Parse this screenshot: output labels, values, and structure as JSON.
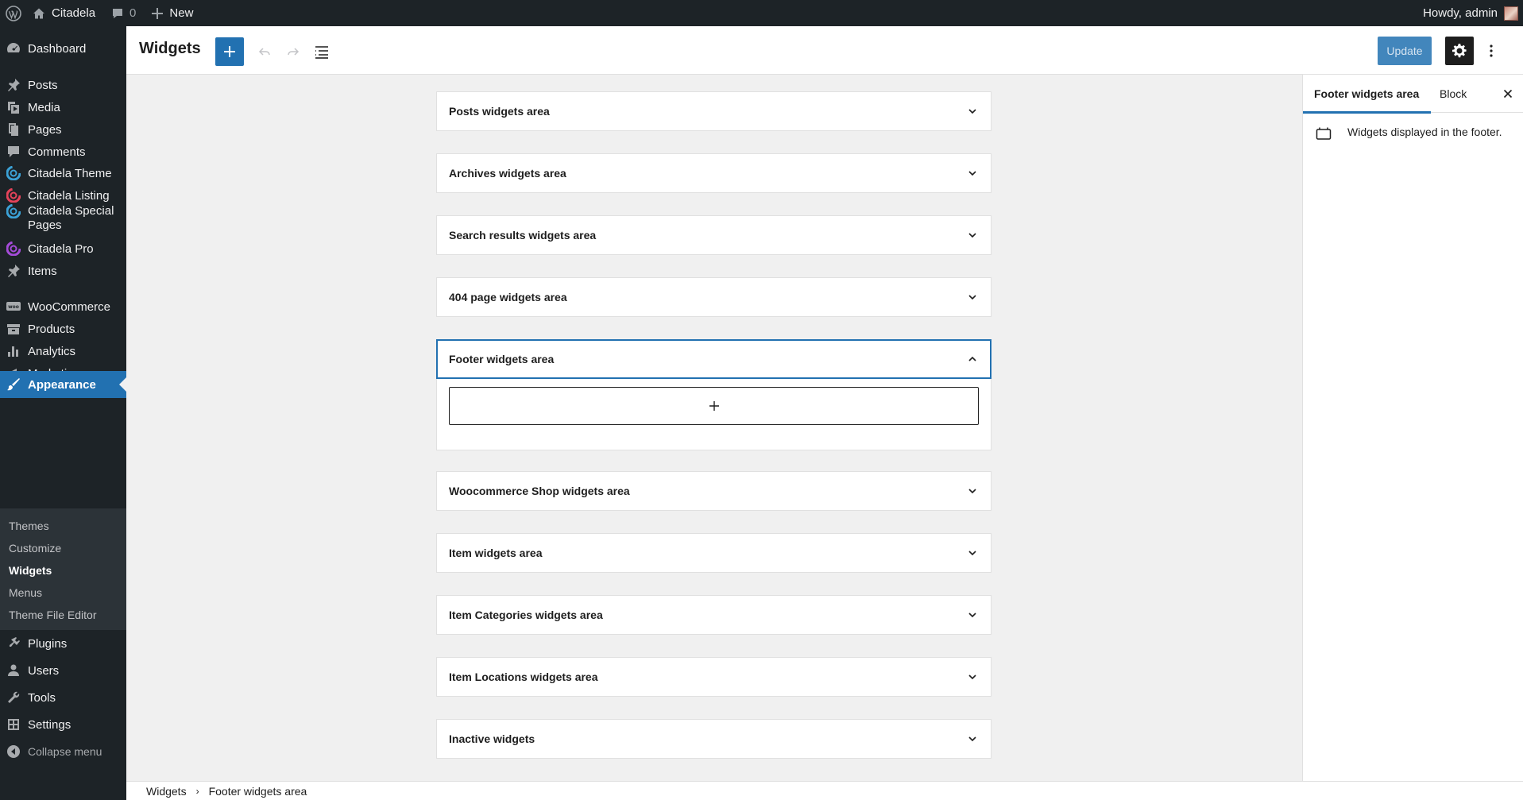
{
  "adminbar": {
    "site_name": "Citadela",
    "comment_count": "0",
    "new_label": "New",
    "greeting": "Howdy, admin"
  },
  "sidebar": {
    "items": [
      {
        "label": "Dashboard",
        "icon": "dashboard-icon"
      },
      {
        "label": "Posts",
        "icon": "pin-icon"
      },
      {
        "label": "Media",
        "icon": "media-icon"
      },
      {
        "label": "Pages",
        "icon": "pages-icon"
      },
      {
        "label": "Comments",
        "icon": "comment-icon"
      },
      {
        "label": "Citadela Theme",
        "icon": "citadela-icon"
      },
      {
        "label": "Citadela Listing",
        "icon": "citadela-icon"
      },
      {
        "label": "Citadela Special Pages",
        "icon": "citadela-icon"
      },
      {
        "label": "Citadela Pro",
        "icon": "citadela-icon"
      },
      {
        "label": "Items",
        "icon": "pin-icon"
      },
      {
        "label": "WooCommerce",
        "icon": "woo-icon"
      },
      {
        "label": "Products",
        "icon": "archive-icon"
      },
      {
        "label": "Analytics",
        "icon": "bar-chart-icon"
      },
      {
        "label": "Marketing",
        "icon": "megaphone-icon"
      },
      {
        "label": "Appearance",
        "icon": "brush-icon"
      },
      {
        "label": "Plugins",
        "icon": "plugin-icon"
      },
      {
        "label": "Users",
        "icon": "user-icon"
      },
      {
        "label": "Tools",
        "icon": "wrench-icon"
      },
      {
        "label": "Settings",
        "icon": "settings-icon"
      },
      {
        "label": "Collapse menu",
        "icon": "collapse-icon"
      }
    ],
    "submenu": [
      "Themes",
      "Customize",
      "Widgets",
      "Menus",
      "Theme File Editor"
    ]
  },
  "header": {
    "title": "Widgets",
    "update_label": "Update"
  },
  "widget_areas": [
    "Posts widgets area",
    "Archives widgets area",
    "Search results widgets area",
    "404 page widgets area",
    "Footer widgets area",
    "Woocommerce Shop widgets area",
    "Item widgets area",
    "Item Categories widgets area",
    "Item Locations widgets area",
    "Inactive widgets"
  ],
  "inspector": {
    "tab_area": "Footer widgets area",
    "tab_block": "Block",
    "description": "Widgets displayed in the footer."
  },
  "breadcrumb": {
    "root": "Widgets",
    "current": "Footer widgets area"
  },
  "colors": {
    "accent": "#2271b1",
    "adminbar": "#1d2327"
  }
}
